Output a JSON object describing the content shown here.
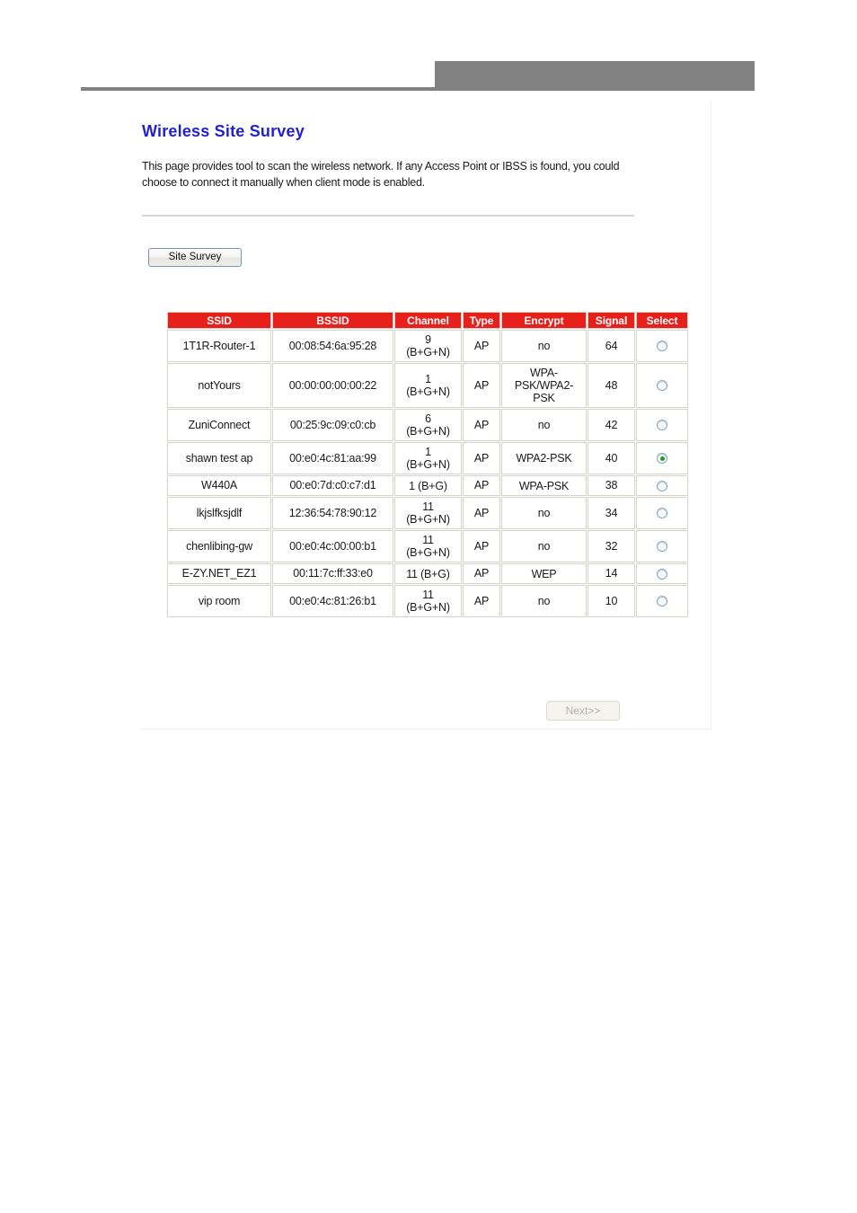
{
  "header": {
    "banner_color": "#818181",
    "rule_color": "#818181"
  },
  "page": {
    "title": "Wireless Site Survey",
    "description": "This page provides tool to scan the wireless network. If any Access Point or IBSS is found, you could choose to connect it manually when client mode is enabled.",
    "title_color": "#2222cc"
  },
  "actions": {
    "site_survey_label": "Site Survey",
    "next_label": "Next>>",
    "next_disabled": true
  },
  "table": {
    "header_color": "#e8201c",
    "columns": [
      "SSID",
      "BSSID",
      "Channel",
      "Type",
      "Encrypt",
      "Signal",
      "Select"
    ],
    "rows": [
      {
        "ssid": "1T1R-Router-1",
        "bssid": "00:08:54:6a:95:28",
        "channel": "9 (B+G+N)",
        "type": "AP",
        "encrypt": "no",
        "signal": "64",
        "selected": false
      },
      {
        "ssid": "notYours",
        "bssid": "00:00:00:00:00:22",
        "channel": "1 (B+G+N)",
        "type": "AP",
        "encrypt": "WPA-PSK/WPA2-PSK",
        "signal": "48",
        "selected": false
      },
      {
        "ssid": "ZuniConnect",
        "bssid": "00:25:9c:09:c0:cb",
        "channel": "6 (B+G+N)",
        "type": "AP",
        "encrypt": "no",
        "signal": "42",
        "selected": false
      },
      {
        "ssid": "shawn test ap",
        "bssid": "00:e0:4c:81:aa:99",
        "channel": "1 (B+G+N)",
        "type": "AP",
        "encrypt": "WPA2-PSK",
        "signal": "40",
        "selected": true
      },
      {
        "ssid": "W440A",
        "bssid": "00:e0:7d:c0:c7:d1",
        "channel": "1 (B+G)",
        "type": "AP",
        "encrypt": "WPA-PSK",
        "signal": "38",
        "selected": false
      },
      {
        "ssid": "lkjslfksjdlf",
        "bssid": "12:36:54:78:90:12",
        "channel": "11 (B+G+N)",
        "type": "AP",
        "encrypt": "no",
        "signal": "34",
        "selected": false
      },
      {
        "ssid": "chenlibing-gw",
        "bssid": "00:e0:4c:00:00:b1",
        "channel": "11 (B+G+N)",
        "type": "AP",
        "encrypt": "no",
        "signal": "32",
        "selected": false
      },
      {
        "ssid": "E-ZY.NET_EZ1",
        "bssid": "00:11:7c:ff:33:e0",
        "channel": "11 (B+G)",
        "type": "AP",
        "encrypt": "WEP",
        "signal": "14",
        "selected": false
      },
      {
        "ssid": "vip room",
        "bssid": "00:e0:4c:81:26:b1",
        "channel": "11 (B+G+N)",
        "type": "AP",
        "encrypt": "no",
        "signal": "10",
        "selected": false
      }
    ]
  }
}
